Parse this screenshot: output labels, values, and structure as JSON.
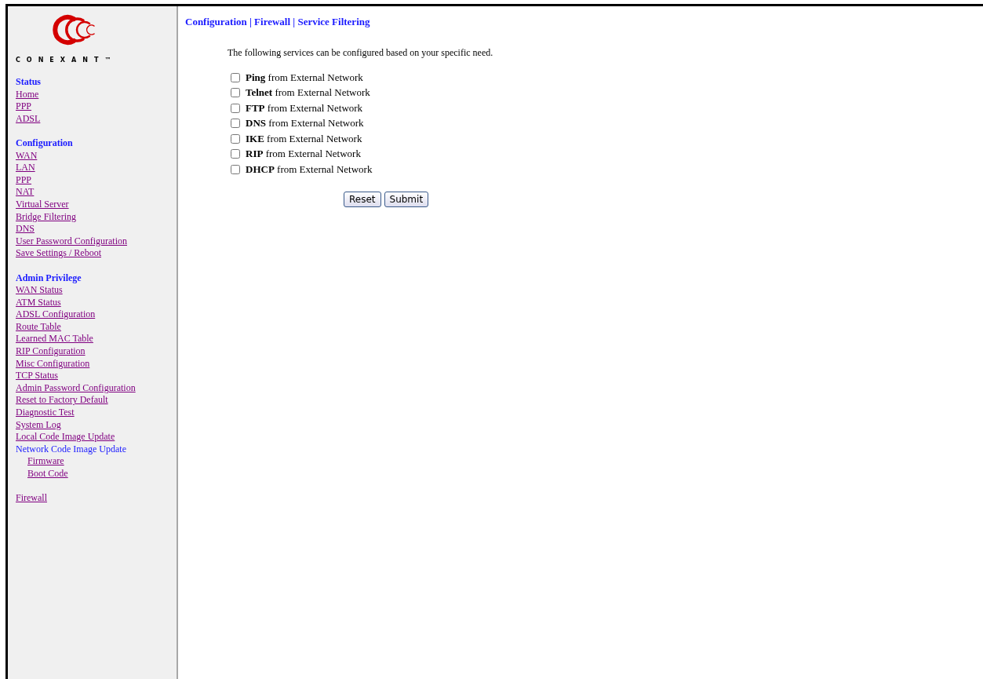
{
  "logo": {
    "wordmark": "CONEXANT™"
  },
  "sidebar": {
    "sections": [
      {
        "heading": "Status",
        "items": [
          {
            "label": "Home",
            "kind": "link"
          },
          {
            "label": "PPP",
            "kind": "link"
          },
          {
            "label": "ADSL",
            "kind": "link"
          }
        ]
      },
      {
        "heading": "Configuration",
        "items": [
          {
            "label": "WAN",
            "kind": "link"
          },
          {
            "label": "LAN",
            "kind": "link"
          },
          {
            "label": "PPP",
            "kind": "link"
          },
          {
            "label": "NAT",
            "kind": "link"
          },
          {
            "label": "Virtual Server",
            "kind": "link"
          },
          {
            "label": "Bridge Filtering",
            "kind": "link"
          },
          {
            "label": "DNS",
            "kind": "link"
          },
          {
            "label": "User Password Configuration",
            "kind": "link"
          },
          {
            "label": "Save Settings / Reboot",
            "kind": "link"
          }
        ]
      },
      {
        "heading": "Admin Privilege",
        "items": [
          {
            "label": "WAN Status",
            "kind": "link"
          },
          {
            "label": "ATM Status",
            "kind": "link"
          },
          {
            "label": "ADSL Configuration",
            "kind": "link"
          },
          {
            "label": "Route Table",
            "kind": "link"
          },
          {
            "label": "Learned MAC Table",
            "kind": "link"
          },
          {
            "label": "RIP Configuration",
            "kind": "link"
          },
          {
            "label": "Misc Configuration",
            "kind": "link"
          },
          {
            "label": "TCP Status",
            "kind": "link"
          },
          {
            "label": "Admin Password Configuration",
            "kind": "link"
          },
          {
            "label": "Reset to Factory Default",
            "kind": "link"
          },
          {
            "label": "Diagnostic Test",
            "kind": "link"
          },
          {
            "label": "System Log",
            "kind": "link"
          },
          {
            "label": "Local Code Image Update",
            "kind": "link"
          },
          {
            "label": "Network Code Image Update",
            "kind": "text",
            "children": [
              {
                "label": "Firmware",
                "kind": "link"
              },
              {
                "label": "Boot Code",
                "kind": "link"
              }
            ]
          }
        ]
      },
      {
        "items": [
          {
            "label": "Firewall",
            "kind": "link"
          }
        ]
      }
    ]
  },
  "main": {
    "breadcrumb": "Configuration | Firewall | Service Filtering",
    "intro": "The following services can be configured based on your specific need.",
    "services": [
      {
        "label": "**Ping** from External Network",
        "checked": false
      },
      {
        "label": "**Telnet** from External Network",
        "checked": false
      },
      {
        "label": "**FTP** from External Network",
        "checked": false
      },
      {
        "label": "**DNS** from External Network",
        "checked": false
      },
      {
        "label": "**IKE** from External Network",
        "checked": false
      },
      {
        "label": "**RIP** from External Network",
        "checked": false
      },
      {
        "label": "**DHCP** from External Network",
        "checked": false
      }
    ],
    "buttons": [
      "Reset",
      "Submit"
    ]
  }
}
